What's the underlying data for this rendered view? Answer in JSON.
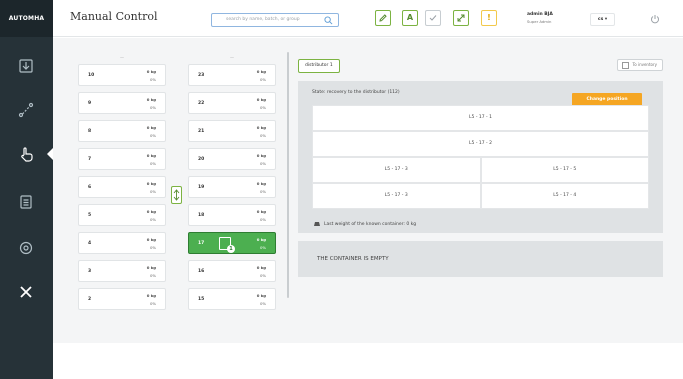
{
  "app": {
    "logo": "AUTOMHA",
    "title": "Manual Control"
  },
  "search": {
    "placeholder": "search by name, batch, or group"
  },
  "toolbar": {
    "btn_a_label": "A",
    "btn_alert_label": "!"
  },
  "user": {
    "name": "admin BJA",
    "role": "Super Admin"
  },
  "language": "cs ▾",
  "sidebar": {
    "items": [
      {
        "icon": "import-icon"
      },
      {
        "icon": "route-icon"
      },
      {
        "icon": "hand-pointer-icon",
        "active": true
      },
      {
        "icon": "document-icon"
      },
      {
        "icon": "settings-icon"
      },
      {
        "icon": "tools-icon"
      }
    ]
  },
  "columns": {
    "left": {
      "header": "—",
      "cells": [
        {
          "num": "10",
          "kg": "0 kg",
          "pct": "0%"
        },
        {
          "num": "9",
          "kg": "0 kg",
          "pct": "0%"
        },
        {
          "num": "8",
          "kg": "0 kg",
          "pct": "0%"
        },
        {
          "num": "7",
          "kg": "0 kg",
          "pct": "0%"
        },
        {
          "num": "6",
          "kg": "0 kg",
          "pct": "0%"
        },
        {
          "num": "5",
          "kg": "0 kg",
          "pct": "0%"
        },
        {
          "num": "4",
          "kg": "0 kg",
          "pct": "0%"
        },
        {
          "num": "3",
          "kg": "0 kg",
          "pct": "0%"
        },
        {
          "num": "2",
          "kg": "0 kg",
          "pct": "0%"
        }
      ]
    },
    "right": {
      "header": "—",
      "cells": [
        {
          "num": "23",
          "kg": "0 kg",
          "pct": "0%"
        },
        {
          "num": "22",
          "kg": "0 kg",
          "pct": "0%"
        },
        {
          "num": "21",
          "kg": "0 kg",
          "pct": "0%"
        },
        {
          "num": "20",
          "kg": "0 kg",
          "pct": "0%"
        },
        {
          "num": "19",
          "kg": "0 kg",
          "pct": "0%"
        },
        {
          "num": "18",
          "kg": "0 kg",
          "pct": "0%"
        },
        {
          "num": "17",
          "kg": "0 kg",
          "pct": "0%",
          "selected": true,
          "badge": "1"
        },
        {
          "num": "16",
          "kg": "0 kg",
          "pct": "0%"
        },
        {
          "num": "15",
          "kg": "0 kg",
          "pct": "0%"
        }
      ]
    }
  },
  "detail": {
    "tab": "distributor 1",
    "to_inventory": "To inventory",
    "state": "State: recovery to the distributor (112)",
    "change_position": "Change position",
    "grid": {
      "row1": "L5 - 17 - 1",
      "row2": "L5 - 17 - 2",
      "row3a": "L5 - 17 - 3",
      "row3b": "L5 - 17 - 5",
      "row4a": "L5 - 17 - 3",
      "row4b": "L5 - 17 - 4"
    },
    "last_weight": "Last weight of the known container: 0 kg",
    "empty_message": "THE CONTAINER IS EMPTY"
  },
  "colors": {
    "sidebar": "#263238",
    "accent_green": "#4caf50",
    "accent_orange": "#f5a623",
    "panel_gray": "#dfe2e4"
  }
}
